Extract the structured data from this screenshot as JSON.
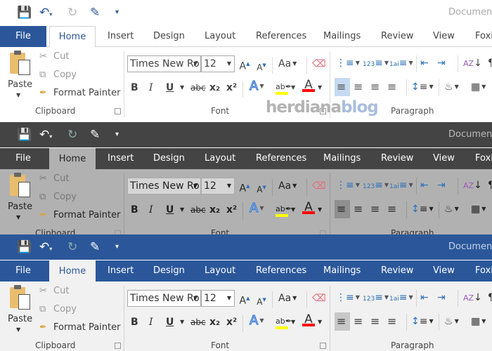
{
  "document_title": "Document",
  "tabs": [
    "File",
    "Home",
    "Insert",
    "Design",
    "Layout",
    "References",
    "Mailings",
    "Review",
    "View",
    "Foxi"
  ],
  "clipboard": {
    "paste": "Paste",
    "cut": "Cut",
    "copy": "Copy",
    "format_painter": "Format Painter",
    "group_label": "Clipboard"
  },
  "font": {
    "font_name": "Times New Ro",
    "font_size": "12",
    "change_case": "Aa",
    "bold": "B",
    "italic": "I",
    "underline": "U",
    "strikethrough": "abc",
    "subscript": "x₂",
    "superscript": "x²",
    "group_label": "Font"
  },
  "paragraph": {
    "group_label": "Paragraph"
  },
  "watermark": {
    "part1": "herdiana",
    "part2": "blog"
  },
  "themes": [
    {
      "name": "white",
      "titlebar": "#ffffff",
      "ribbon": "#ffffff",
      "file_tab": "#2b579a"
    },
    {
      "name": "dark-gray",
      "titlebar": "#444444",
      "ribbon": "#b1b1b1",
      "file_tab": "#444444"
    },
    {
      "name": "colorful",
      "titlebar": "#2b579a",
      "ribbon": "#f1f1f1",
      "file_tab": "#2b579a"
    }
  ],
  "colors": {
    "highlight_color": "#ffff00",
    "font_color": "#ff0000",
    "save_icon_white": "#7b3fa0",
    "accent_blue": "#2b579a"
  }
}
